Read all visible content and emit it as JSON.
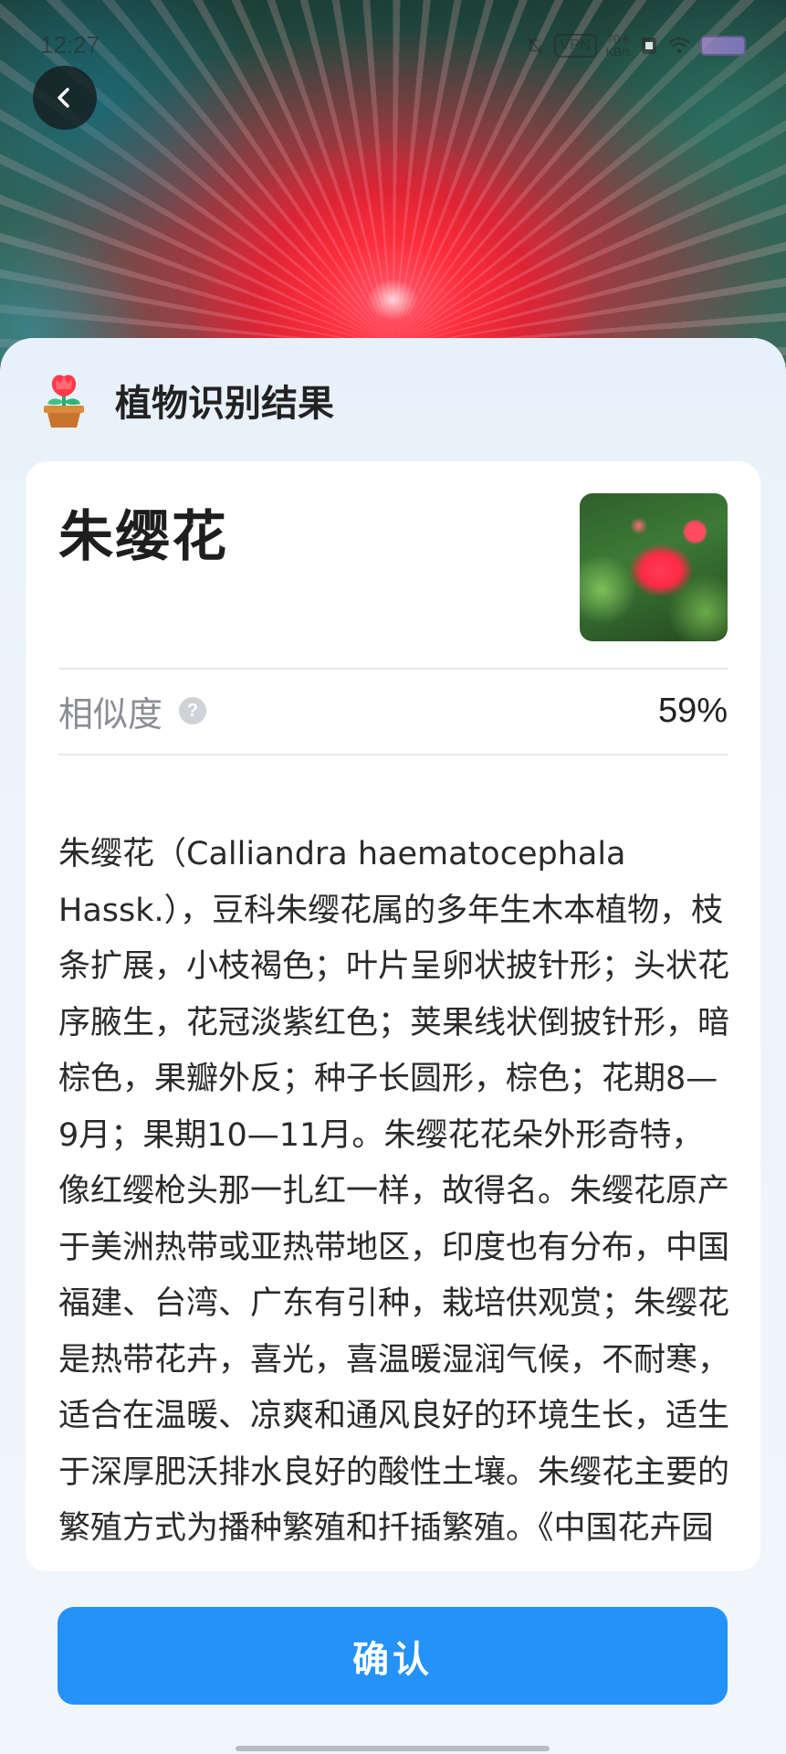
{
  "status_bar": {
    "time": "12:27",
    "vpn": "VPN",
    "net_speed_value": "70.6",
    "net_speed_unit": "KB/s"
  },
  "header": {
    "title": "植物识别结果"
  },
  "result": {
    "name": "朱缨花",
    "similarity_label": "相似度",
    "similarity_help": "?",
    "similarity_value": "59%",
    "description": "朱缨花（Calliandra haematocephala Hassk.），豆科朱缨花属的多年生木本植物，枝条扩展，小枝褐色；叶片呈卵状披针形；头状花序腋生，花冠淡紫红色；荚果线状倒披针形，暗棕色，果瓣外反；种子长圆形，棕色；花期8—9月；果期10—11月。朱缨花花朵外形奇特，像红缨枪头那一扎红一样，故得名。朱缨花原产于美洲热带或亚热带地区，印度也有分布，中国福建、台湾、广东有引种，栽培供观赏；朱缨花是热带花卉，喜光，喜温暖湿润气候，不耐寒，适合在温暖、凉爽和通风良好的环境生长，适生于深厚肥沃排水良好的酸性土壤。朱缨花主要的繁殖方式为播种繁殖和扦插繁殖。《中国花卉园"
  },
  "actions": {
    "confirm_label": "确认"
  },
  "colors": {
    "accent": "#2492f8",
    "sheet_bg": "#e8f1fb"
  }
}
